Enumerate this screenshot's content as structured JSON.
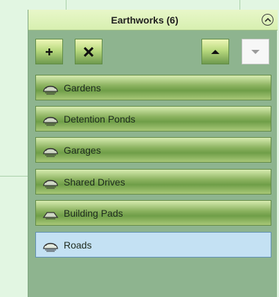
{
  "panel": {
    "title": "Earthworks (6)"
  },
  "toolbar": {
    "add_button": "add-icon",
    "delete_button": "delete-icon",
    "move_up_button": "arrow-up-icon",
    "move_down_button": "arrow-down-icon"
  },
  "earthworks": {
    "items": [
      {
        "label": "Gardens",
        "icon": "earthwork-mound-icon",
        "selected": false
      },
      {
        "label": "Detention Ponds",
        "icon": "earthwork-mound-icon",
        "selected": false
      },
      {
        "label": "Garages",
        "icon": "earthwork-mound-icon",
        "selected": false
      },
      {
        "label": "Shared Drives",
        "icon": "earthwork-mound-icon",
        "selected": false
      },
      {
        "label": "Building Pads",
        "icon": "earthwork-pad-icon",
        "selected": false
      },
      {
        "label": "Roads",
        "icon": "earthwork-mound-icon",
        "selected": true
      }
    ]
  },
  "colors": {
    "background": "#e2f6e2",
    "panel": "#8eb48f",
    "header": "#dff2bd",
    "item_green": "#7ea653",
    "selected": "#c4e1f3"
  }
}
